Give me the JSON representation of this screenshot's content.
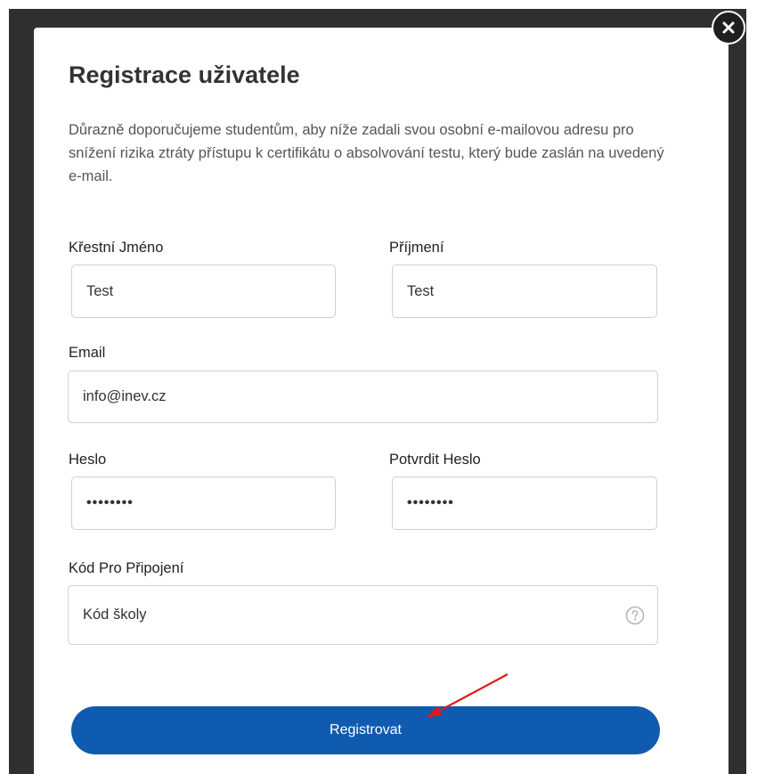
{
  "modal": {
    "title": "Registrace uživatele",
    "intro": "Důrazně doporučujeme studentům, aby níže zadali svou osobní e-mailovou adresu pro snížení rizika ztráty přístupu k certifikátu o absolvování testu, který bude zaslán na uvedený e-mail."
  },
  "form": {
    "first_name": {
      "label": "Křestní Jméno",
      "value": "Test"
    },
    "last_name": {
      "label": "Příjmení",
      "value": "Test"
    },
    "email": {
      "label": "Email",
      "value": "info@inev.cz"
    },
    "password": {
      "label": "Heslo",
      "value": "••••••••"
    },
    "confirm_password": {
      "label": "Potvrdit Heslo",
      "value": "••••••••"
    },
    "join_code": {
      "label": "Kód Pro Připojení",
      "placeholder": "Kód školy"
    },
    "submit_label": "Registrovat"
  },
  "icons": {
    "close": "close-icon",
    "help": "question-circle-icon",
    "annotation": "red-arrow"
  },
  "colors": {
    "primary_button": "#0f5bb0",
    "annotation_arrow": "#e01a1a"
  }
}
